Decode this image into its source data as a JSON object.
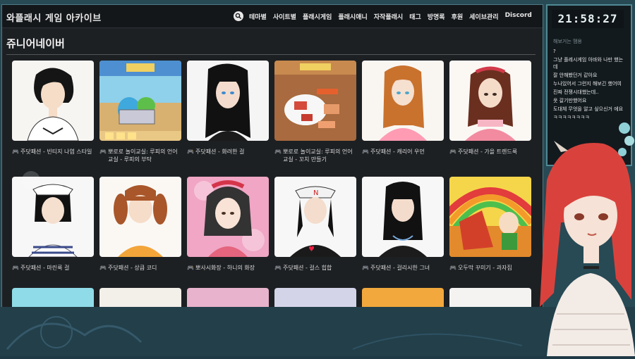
{
  "site": {
    "brand": "와플래시 게임 아카이브",
    "nav": [
      "테마별",
      "사이트별",
      "플래시게임",
      "플래시애니",
      "자작플래시",
      "태그",
      "방명록",
      "후원",
      "세이브관리",
      "Discord"
    ]
  },
  "page": {
    "title": "쥬니어네이버"
  },
  "games": [
    {
      "title": "주닷패션 - 빈티지 나염 스타일"
    },
    {
      "title": "뽀로로 놀이교실: 루피의 언어교실 - 루피의 부탁"
    },
    {
      "title": "주닷패션 - 화려한 걸"
    },
    {
      "title": "뽀로로 놀이교실: 루피의 언어교실 - 꼬치 만들기"
    },
    {
      "title": "주닷패션 - 캐리어 우먼"
    },
    {
      "title": "주닷패션 - 가을 트렌드룩"
    },
    {
      "title": "주닷패션 - 마린룩 걸"
    },
    {
      "title": "주닷패션 - 상큼 코디"
    },
    {
      "title": "뽀사시화장 - 하니의 화장"
    },
    {
      "title": "주닷패션 - 걸스 힙합"
    },
    {
      "title": "주닷패션 - 걸리시한 그녀"
    },
    {
      "title": "오두막 꾸미기 - 과자집"
    }
  ],
  "stream": {
    "clock": "21:58:27",
    "chat_header": "해보거는 맴용",
    "chat": [
      "?",
      "그냥 플레시게임 아바와 나만 했는데",
      "잘 안해봤던거 같아요",
      "누나있어서 그런지 해보긴 했어여",
      "진짜 전쟁시대했는데..",
      "옷 갈기만했어요",
      "도대체 무엇을 알고 싶으신거 에요",
      "ㅋㅋㅋㅋㅋㅋㅋㅋ"
    ]
  },
  "colors": {
    "accent_teal": "#4f8a94",
    "page_bg": "#1d2023"
  }
}
